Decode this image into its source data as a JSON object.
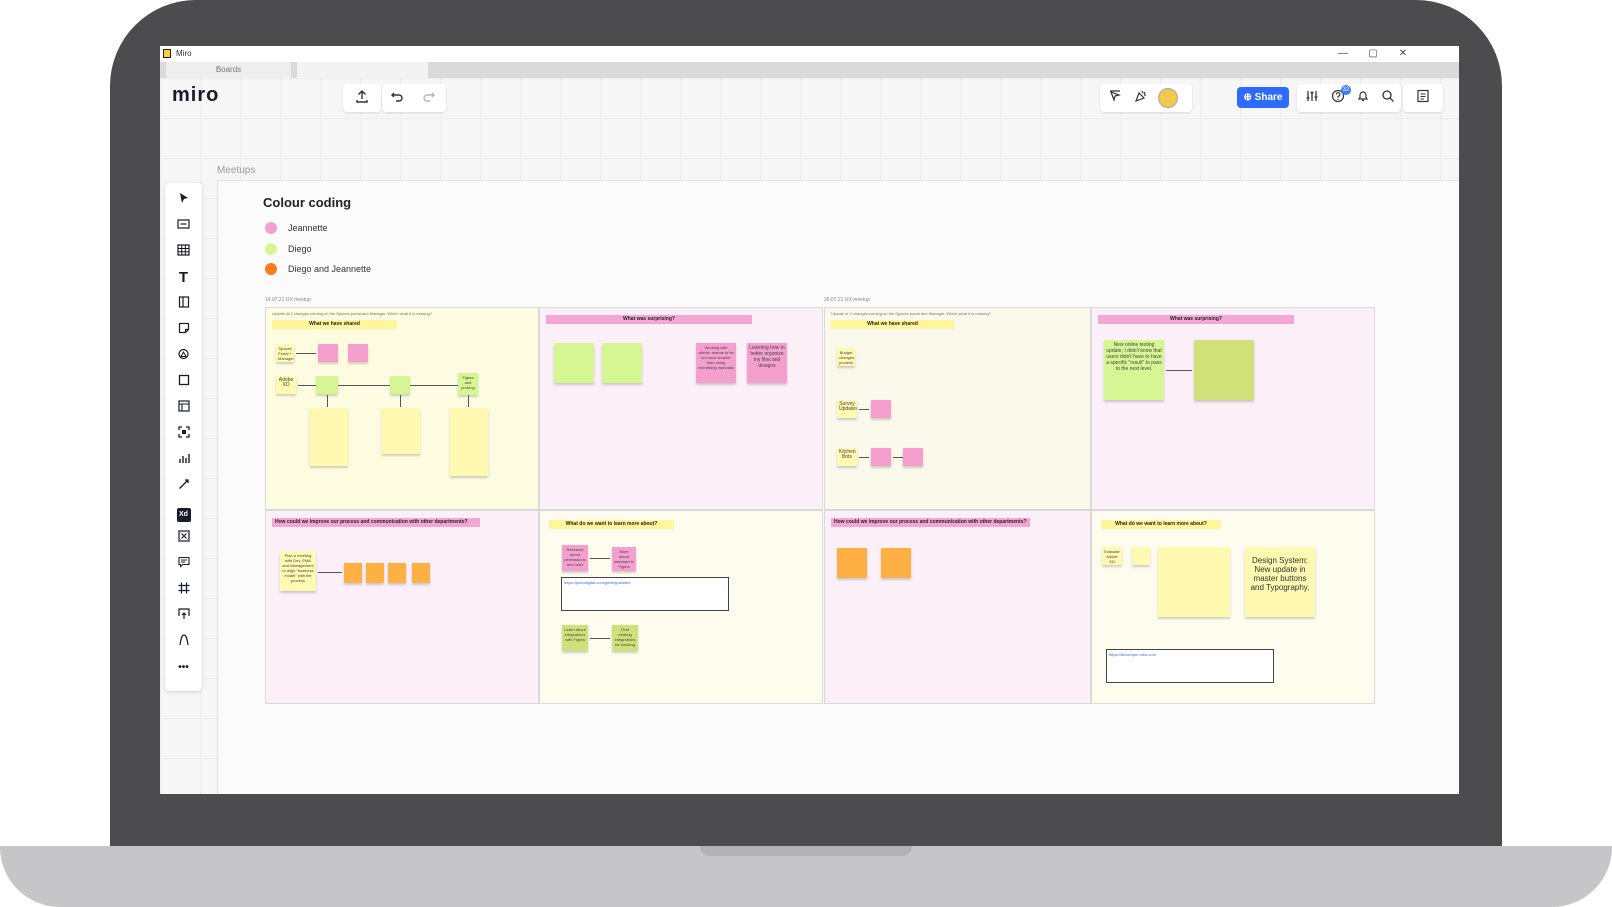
{
  "window": {
    "title": "Miro",
    "tab": "Boards",
    "controls": [
      "—",
      "▢",
      "✕"
    ]
  },
  "toolbar": {
    "logo": "miro",
    "upload_icon": "upload-icon",
    "undo_icon": "undo-icon",
    "redo_icon": "redo-icon",
    "share_label": "⊕ Share",
    "notifications_badge": "32",
    "colors": {
      "share": "#2d6aff",
      "accent": "#ffd02f"
    }
  },
  "sidebar": {
    "tools": [
      "select-icon",
      "text-box-icon",
      "table-icon",
      "text-icon",
      "card-icon",
      "sticky-note-icon",
      "shapes-icon",
      "rectangle-icon",
      "frame-template-icon",
      "crop-icon",
      "chart-icon",
      "pen-icon",
      "xd-icon",
      "cross-box-icon",
      "comment-icon",
      "frame-icon",
      "upload-icon",
      "curve-icon",
      "more-icon"
    ],
    "xd_label": "Xd",
    "more_label": "•••"
  },
  "board": {
    "frame_label": "Meetups",
    "legend": {
      "title": "Colour coding",
      "items": [
        {
          "label": "Jeannette",
          "color": "#f59fce"
        },
        {
          "label": "Diego",
          "color": "#d5f692"
        },
        {
          "label": "Diego and Jeannette",
          "color": "#ff7a1a"
        }
      ]
    },
    "meetups": [
      {
        "date": "14.07.21 UX meetup",
        "intro": "Update of 2 changes coming on the Spaces portal and Manager. Which what it is missing?",
        "q1": "What we have shared",
        "q2": "What was surprising?",
        "q3": "How could we improve our process and communication with other departments?",
        "q4": "What do we want to learn more about?",
        "stickies": {
          "spaces": "Spaces Portal + Manager Upgrade",
          "adobe": "Adobe XD",
          "figma": "Figma and probing",
          "meeting": "Plan a meeting with Dev, PMA and Management to align \"business model\" with the process",
          "learning": "Learning how to better organize my files and designs",
          "working": "Working with clients: seems to be so much smarter than doing everything manually",
          "research": "Research about permissions and roles",
          "more": "More about standard in Figma",
          "learnabout": "Learn about integrations with Figma",
          "exist": "Find existing integrations for tracking",
          "links": "https://plutodigital.com/getting-started"
        }
      },
      {
        "date": "29.07.21 UX meetup",
        "intro": "Update of 2 changes coming on the Spaces portal and Manager. Which what it is missing?",
        "q1": "What we have shared",
        "q2": "What was surprising?",
        "q3": "How could we improve our process and communication with other departments?",
        "q4": "What do we want to learn more about?",
        "stickies": {
          "budget": "Budget changes process",
          "survey": "Survey Updates",
          "kitchen": "Kitchen Bots",
          "online": "New online testing update, I didn't know that users didn't have to have a specific \"result\" to pass to the next level.",
          "ds": "Design System: New update in master buttons and Typography.",
          "eval": "Evaluate Adobe XD",
          "links": "https://developer.miro.com"
        }
      }
    ]
  }
}
